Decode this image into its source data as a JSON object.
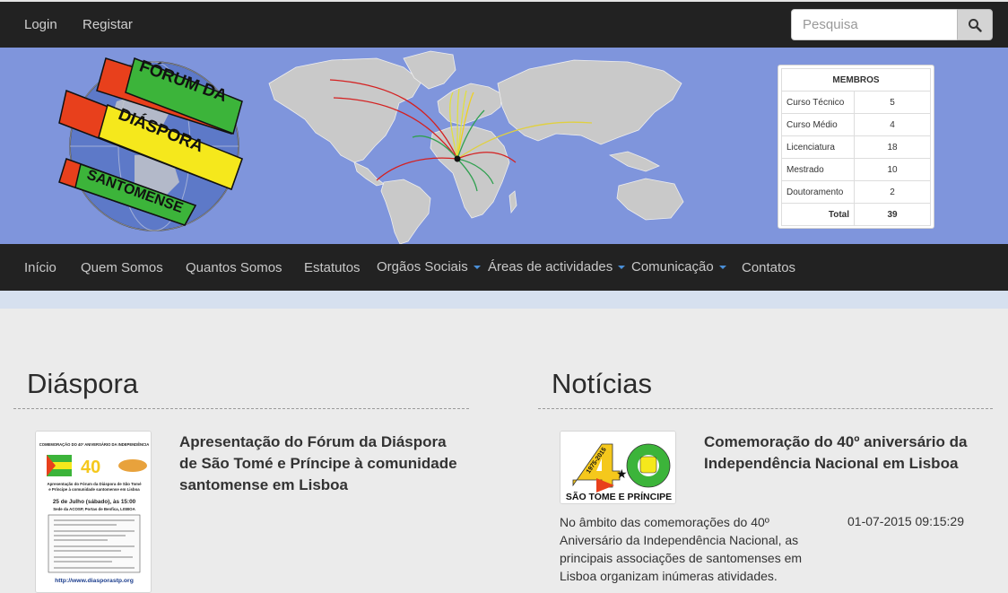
{
  "topbar": {
    "login": "Login",
    "register": "Registar",
    "search_placeholder": "Pesquisa"
  },
  "banner": {
    "logo_lines": [
      "FÓRUM DA",
      "DIÁSPORA",
      "SANTOMENSE"
    ],
    "members": {
      "header": "MEMBROS",
      "rows": [
        {
          "label": "Curso Técnico",
          "value": "5"
        },
        {
          "label": "Curso Médio",
          "value": "4"
        },
        {
          "label": "Licenciatura",
          "value": "18"
        },
        {
          "label": "Mestrado",
          "value": "10"
        },
        {
          "label": "Doutoramento",
          "value": "2"
        }
      ],
      "total_label": "Total",
      "total_value": "39"
    }
  },
  "nav": {
    "items": [
      "Início",
      "Quem Somos",
      "Quantos Somos",
      "Estatutos",
      "Orgãos Sociais",
      "Áreas de actividades",
      "Comunicação",
      "Contatos"
    ]
  },
  "diaspora": {
    "title": "Diáspora",
    "article_title": "Apresentação do Fórum da Diáspora de São Tomé e Príncipe à comunidade santomense em Lisboa",
    "poster": {
      "heading": "COMEMORAÇÃO DO 40º ANIVERSÁRIO DA INDEPENDÊNCIA",
      "line1": "Apresentação do Fórum da Diáspora de São Tomé",
      "line2": "e Príncipe à comunidade santomense em Lisboa",
      "date": "25 de Julho (sábado), às 15:00",
      "venue": "Sede da ACOSP, Portas de Benfica, LISBOA",
      "url": "http://www.diasporastp.org"
    }
  },
  "news": {
    "title": "Notícias",
    "article_title": "Comemoração do 40º aniversário da Independência Nacional em Lisboa",
    "body": "No âmbito das comemorações do 40º Aniversário da Independência Nacional, as principais associações de santomenses em Lisboa organizam inúmeras atividades.",
    "date": "01-07-2015 09:15:29",
    "thumb": {
      "years": "1975-2015",
      "caption": "SÃO TOME E PRÍNCIPE"
    }
  },
  "colors": {
    "banner_bg": "#7f95dc",
    "bar_bg": "#222222",
    "logo_red": "#e8401c",
    "logo_green": "#3cb43a",
    "logo_yellow": "#f5e81c",
    "caret_blue": "#4a8fd8"
  }
}
